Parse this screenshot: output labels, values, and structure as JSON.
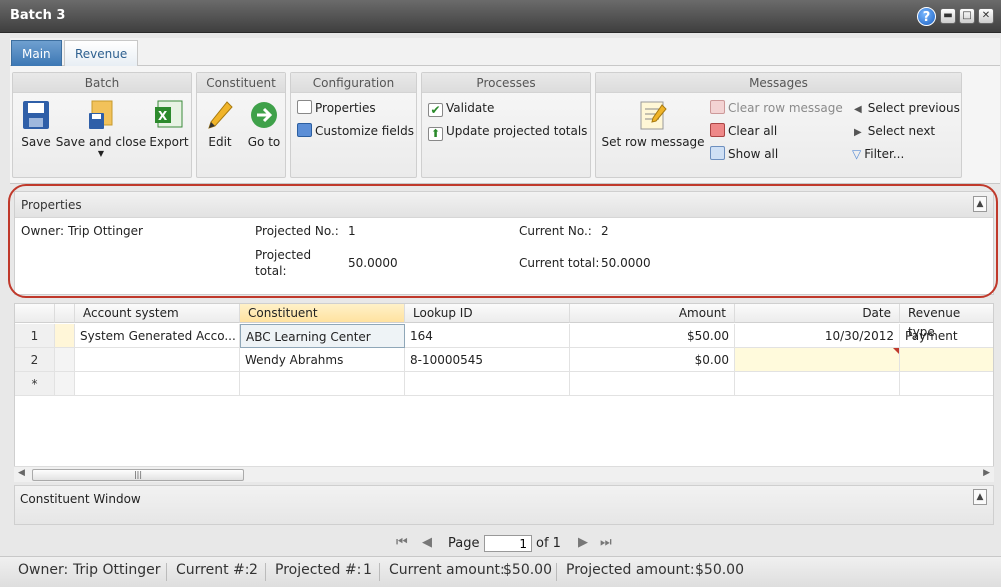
{
  "window": {
    "title": "Batch 3"
  },
  "tabs": [
    {
      "label": "Main",
      "active": true
    },
    {
      "label": "Revenue",
      "active": false
    }
  ],
  "ribbon": {
    "batch": {
      "title": "Batch",
      "save": "Save",
      "save_and_close": "Save and close",
      "export": "Export"
    },
    "constituent": {
      "title": "Constituent",
      "edit": "Edit",
      "go_to": "Go to"
    },
    "configuration": {
      "title": "Configuration",
      "properties": "Properties",
      "customize_fields": "Customize fields"
    },
    "processes": {
      "title": "Processes",
      "validate": "Validate",
      "update_projected_totals": "Update projected totals"
    },
    "messages": {
      "title": "Messages",
      "set_row_message": "Set row message",
      "clear_row_message": "Clear row message",
      "clear_all": "Clear all",
      "show_all": "Show all",
      "select_previous": "Select previous",
      "select_next": "Select next",
      "filter": "Filter..."
    }
  },
  "properties": {
    "title": "Properties",
    "owner_label": "Owner:",
    "owner_value": "Trip Ottinger",
    "projected_no_label": "Projected No.:",
    "projected_no_value": "1",
    "projected_total_label_1": "Projected",
    "projected_total_label_2": "total:",
    "projected_total_value": "50.0000",
    "current_no_label": "Current No.:",
    "current_no_value": "2",
    "current_total_label": "Current total:",
    "current_total_value": "50.0000"
  },
  "grid": {
    "columns": [
      "Account system",
      "Constituent",
      "Lookup ID",
      "Amount",
      "Date",
      "Revenue type"
    ],
    "rows": [
      {
        "num": "1",
        "account_system": "System Generated Acco...",
        "constituent": "ABC Learning Center",
        "lookup_id": "164",
        "amount": "$50.00",
        "date": "10/30/2012",
        "revenue_type": "Payment"
      },
      {
        "num": "2",
        "account_system": "",
        "constituent": "Wendy Abrahms",
        "lookup_id": "8-10000545",
        "amount": "$0.00",
        "date": "",
        "revenue_type": ""
      },
      {
        "num": "*",
        "account_system": "",
        "constituent": "",
        "lookup_id": "",
        "amount": "",
        "date": "",
        "revenue_type": ""
      }
    ]
  },
  "constituent_window": {
    "title": "Constituent Window"
  },
  "pager": {
    "page_label": "Page",
    "page_value": "1",
    "of_label": "of 1"
  },
  "status": {
    "owner_label": "Owner:",
    "owner_value": "Trip Ottinger",
    "current_label": "Current #:",
    "current_value": "2",
    "projected_label": "Projected #:",
    "projected_value": "1",
    "current_amount_label": "Current amount:",
    "current_amount_value": "$50.00",
    "projected_amount_label": "Projected amount:",
    "projected_amount_value": "$50.00"
  },
  "colors": {
    "highlight_row": "#fff8d8",
    "accent_border": "#c0392b",
    "active_tab": "#3c77b4"
  }
}
